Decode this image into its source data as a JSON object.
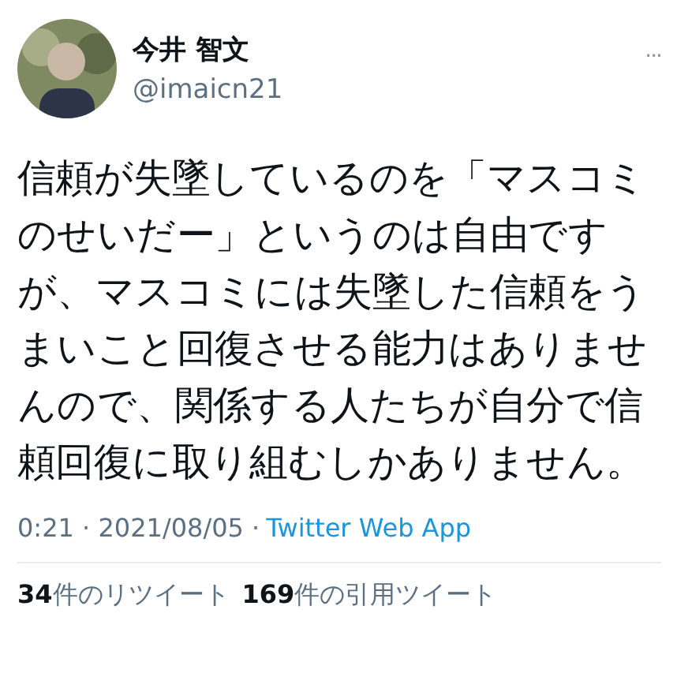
{
  "author": {
    "name": "今井 智文",
    "handle": "@imaicn21"
  },
  "menu": "···",
  "body": "信頼が失墜しているのを「マスコミのせいだー」というのは自由ですが、マスコミには失墜した信頼をうまいこと回復させる能力はありませんので、関係する人たちが自分で信頼回復に取り組むしかありません。",
  "meta": {
    "time": "0:21",
    "separator": "·",
    "date": "2021/08/05",
    "source": "Twitter Web App"
  },
  "stats": [
    "**34**件のリツイート",
    "**169**件の引用ツイート"
  ]
}
